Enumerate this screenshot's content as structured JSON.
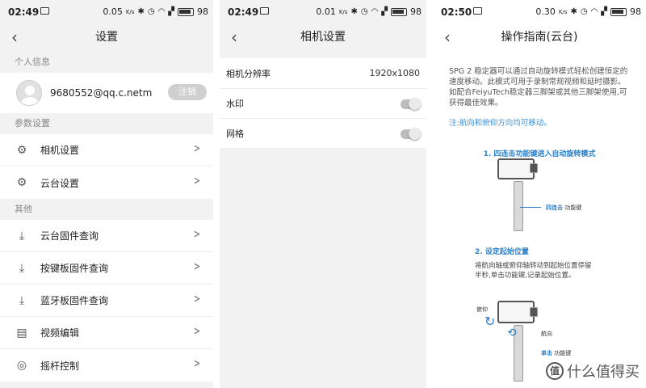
{
  "screen1": {
    "status": {
      "time": "02:49",
      "speed": "0.05",
      "unit": "K/s",
      "battery": "98"
    },
    "title": "设置",
    "personal_label": "个人信息",
    "email": "9680552@qq.c.netm",
    "logout_label": "注销",
    "params_label": "参数设置",
    "params_items": [
      {
        "label": "相机设置",
        "icon": "gears-icon"
      },
      {
        "label": "云台设置",
        "icon": "gears-icon"
      }
    ],
    "other_label": "其他",
    "other_items": [
      {
        "label": "云台固件查询",
        "icon": "download-icon"
      },
      {
        "label": "按键板固件查询",
        "icon": "download-icon"
      },
      {
        "label": "蓝牙板固件查询",
        "icon": "download-icon"
      },
      {
        "label": "视频编辑",
        "icon": "clapperboard-icon"
      },
      {
        "label": "摇杆控制",
        "icon": "joystick-icon"
      }
    ]
  },
  "screen2": {
    "status": {
      "time": "02:49",
      "speed": "0.01",
      "unit": "K/s",
      "battery": "98"
    },
    "title": "相机设置",
    "resolution_label": "相机分辨率",
    "resolution_value": "1920x1080",
    "watermark_label": "水印",
    "grid_label": "网格"
  },
  "screen3": {
    "status": {
      "time": "02:50",
      "speed": "0.30",
      "unit": "K/s",
      "battery": "98"
    },
    "title": "操作指南(云台)",
    "intro": "SPG 2 稳定器可以通过自动旋转模式轻松创建恒定的速度移动。此模式可用于录制常规视频和延时摄影。如配合FeiyuTech稳定器三脚架或其他三脚架使用,可获得最佳效果。",
    "note": "注:航向和俯仰方向均可移动。",
    "step1_title": "1. 四连击功能键进入自动旋转模式",
    "step1_callout_bold": "四连击",
    "step1_callout": "功能键",
    "step2_title": "2. 设定起始位置",
    "step2_desc": "将航向轴或俯仰轴转动到起始位置停留半秒,单击功能键,记录起始位置。",
    "label_pitch": "俯仰",
    "label_yaw": "航向",
    "step2_callout_bold": "单击",
    "step2_callout": "功能键",
    "watermark_text": "什么值得买",
    "watermark_logo": "值"
  }
}
